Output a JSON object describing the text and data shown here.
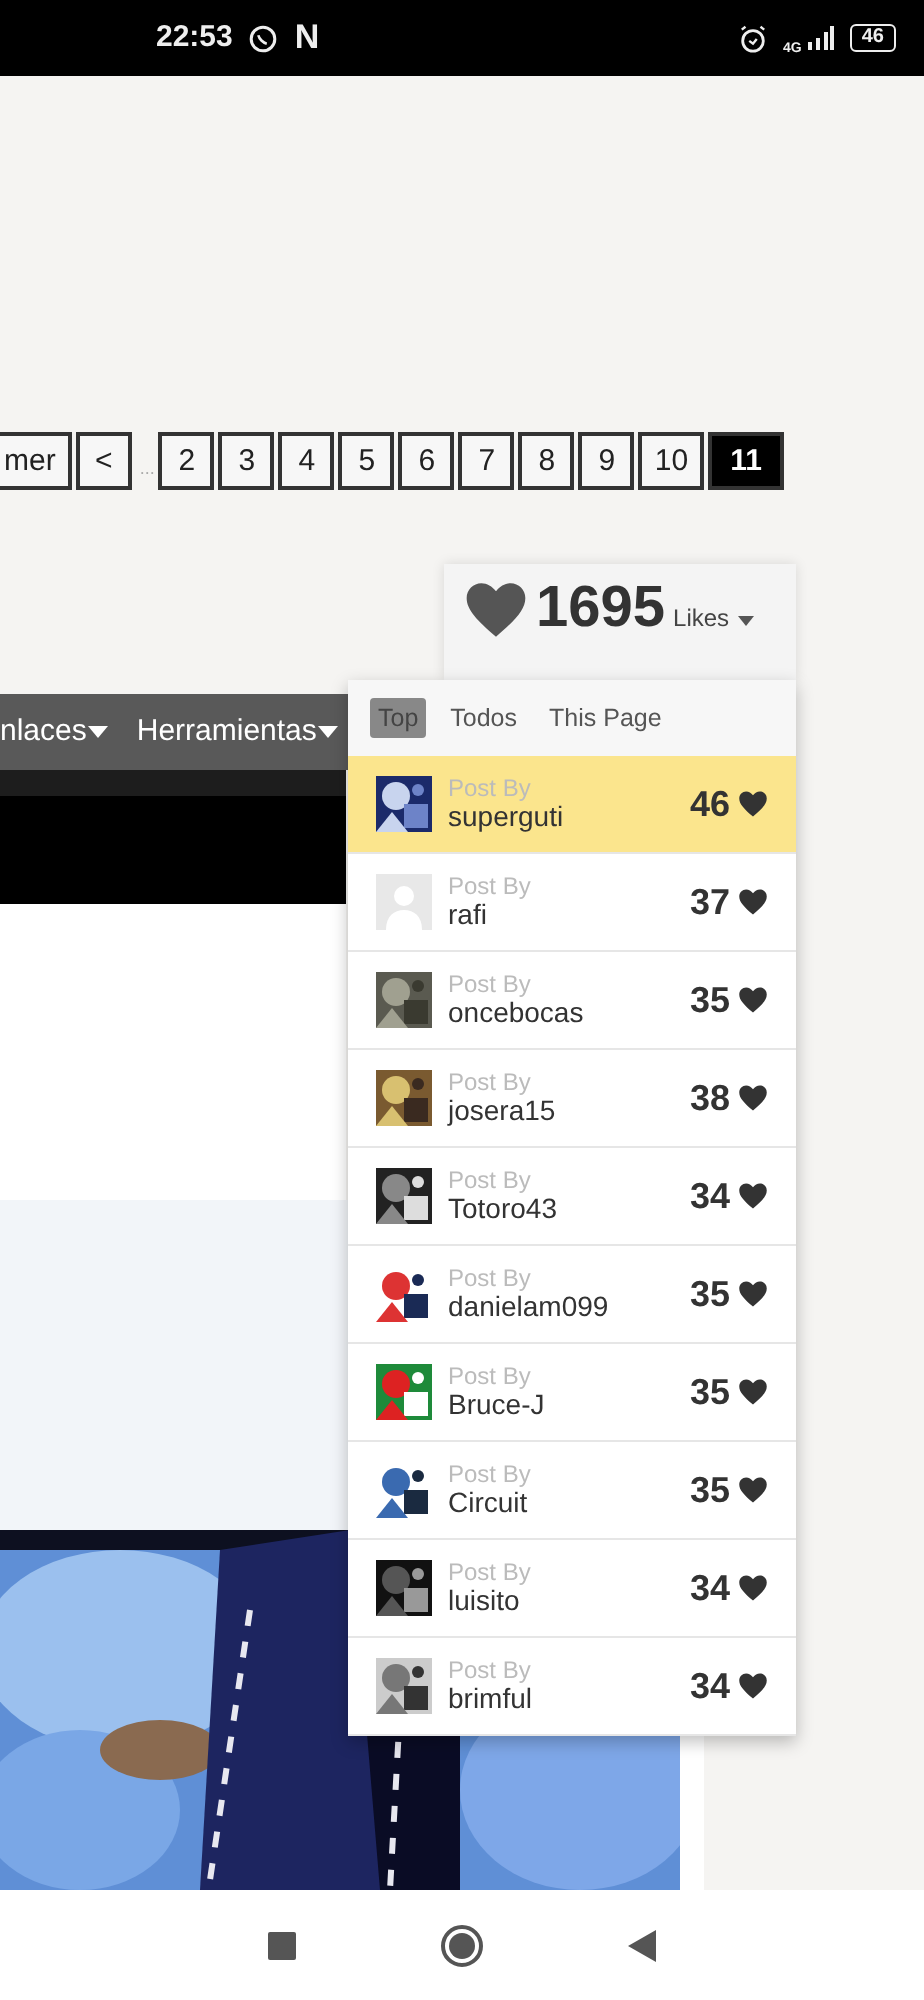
{
  "status_bar": {
    "time": "22:53",
    "notification_letter": "N",
    "network": "4G",
    "battery": "46"
  },
  "pagination": {
    "pages": [
      {
        "label": "mer",
        "selected": false
      },
      {
        "label": "<",
        "selected": false
      },
      {
        "label": "2",
        "selected": false
      },
      {
        "label": "3",
        "selected": false
      },
      {
        "label": "4",
        "selected": false
      },
      {
        "label": "5",
        "selected": false
      },
      {
        "label": "6",
        "selected": false
      },
      {
        "label": "7",
        "selected": false
      },
      {
        "label": "8",
        "selected": false
      },
      {
        "label": "9",
        "selected": false
      },
      {
        "label": "10",
        "selected": false
      },
      {
        "label": "11",
        "selected": true
      }
    ],
    "ellipsis": "..."
  },
  "nav": {
    "items": [
      "nlaces",
      "Herramientas"
    ]
  },
  "likes": {
    "total": "1695",
    "label": "Likes",
    "tabs": [
      {
        "label": "Top",
        "selected": true
      },
      {
        "label": "Todos",
        "selected": false
      },
      {
        "label": "This Page",
        "selected": false
      }
    ],
    "posts": [
      {
        "caption": "Post By",
        "user": "superguti",
        "likes": "46",
        "highlighted": true,
        "kind": "picture"
      },
      {
        "caption": "Post By",
        "user": "rafi",
        "likes": "37",
        "highlighted": false,
        "kind": "placeholder"
      },
      {
        "caption": "Post By",
        "user": "oncebocas",
        "likes": "35",
        "highlighted": false,
        "kind": "picture"
      },
      {
        "caption": "Post By",
        "user": "josera15",
        "likes": "38",
        "highlighted": false,
        "kind": "picture"
      },
      {
        "caption": "Post By",
        "user": "Totoro43",
        "likes": "34",
        "highlighted": false,
        "kind": "picture"
      },
      {
        "caption": "Post By",
        "user": "danielam099",
        "likes": "35",
        "highlighted": false,
        "kind": "picture"
      },
      {
        "caption": "Post By",
        "user": "Bruce-J",
        "likes": "35",
        "highlighted": false,
        "kind": "picture"
      },
      {
        "caption": "Post By",
        "user": "Circuit",
        "likes": "35",
        "highlighted": false,
        "kind": "picture"
      },
      {
        "caption": "Post By",
        "user": "luisito",
        "likes": "34",
        "highlighted": false,
        "kind": "picture"
      },
      {
        "caption": "Post By",
        "user": "brimful",
        "likes": "34",
        "highlighted": false,
        "kind": "picture"
      }
    ]
  }
}
